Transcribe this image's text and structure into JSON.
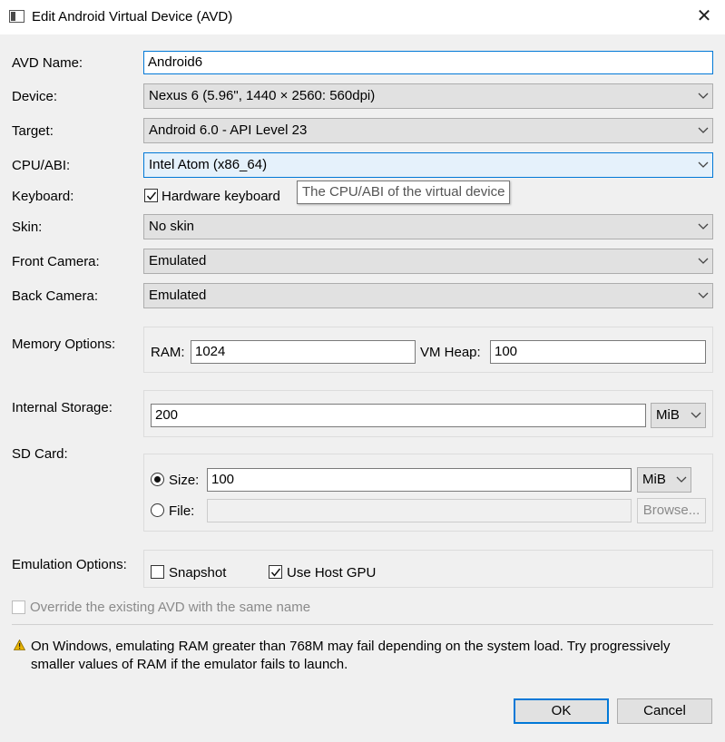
{
  "window": {
    "title": "Edit Android Virtual Device (AVD)",
    "close_glyph": "✕"
  },
  "labels": {
    "avd_name": "AVD Name:",
    "device": "Device:",
    "target": "Target:",
    "cpu_abi": "CPU/ABI:",
    "keyboard": "Keyboard:",
    "skin": "Skin:",
    "front_camera": "Front Camera:",
    "back_camera": "Back Camera:",
    "memory_options": "Memory Options:",
    "internal_storage": "Internal Storage:",
    "sd_card": "SD Card:",
    "emulation_options": "Emulation Options:"
  },
  "fields": {
    "avd_name": "Android6",
    "device": "Nexus 6 (5.96\", 1440 × 2560: 560dpi)",
    "target": "Android 6.0 - API Level 23",
    "cpu_abi": "Intel Atom (x86_64)",
    "skin": "No skin",
    "front_camera": "Emulated",
    "back_camera": "Emulated"
  },
  "keyboard": {
    "label": "Hardware keyboard",
    "checked": true
  },
  "tooltip": "The CPU/ABI of the virtual device",
  "memory": {
    "ram_label": "RAM:",
    "ram_value": "1024",
    "vm_heap_label": "VM Heap:",
    "vm_heap_value": "100"
  },
  "internal_storage": {
    "value": "200",
    "unit": "MiB"
  },
  "sd_card": {
    "size_label": "Size:",
    "size_value": "100",
    "size_unit": "MiB",
    "size_selected": true,
    "file_label": "File:",
    "file_value": "",
    "browse_label": "Browse..."
  },
  "emulation": {
    "snapshot_label": "Snapshot",
    "snapshot_checked": false,
    "host_gpu_label": "Use Host GPU",
    "host_gpu_checked": true
  },
  "override_label": "Override the existing AVD with the same name",
  "warning": "On Windows, emulating RAM greater than 768M may fail depending on the system load. Try progressively smaller values of RAM if the emulator fails to launch.",
  "buttons": {
    "ok": "OK",
    "cancel": "Cancel"
  },
  "colors": {
    "accent": "#0078d7",
    "background": "#f0f0f0",
    "warning": "#e8b400"
  }
}
